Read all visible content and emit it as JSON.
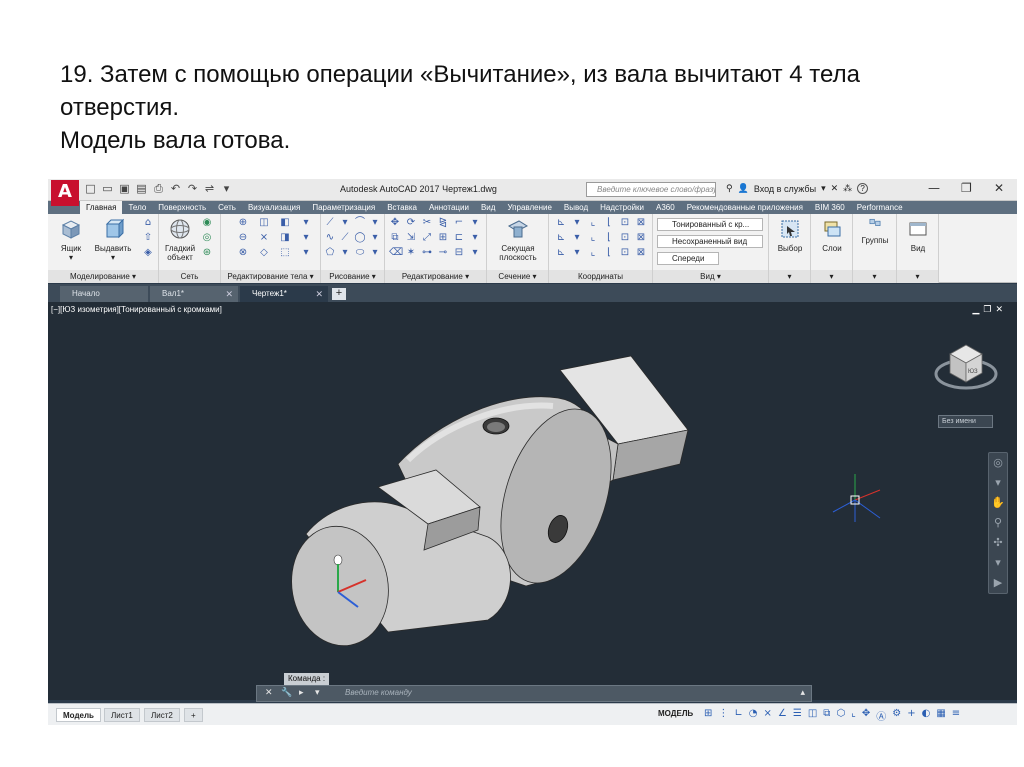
{
  "slide": {
    "caption_lines": [
      "19. Затем с помощью операции «Вычитание», из вала вычитают 4 тела",
      "отверстия.",
      "Модель вала готова."
    ]
  },
  "app": {
    "logo": "A",
    "title": "Autodesk AutoCAD 2017   Чертеж1.dwg",
    "search_placeholder": "Введите ключевое слово/фразу",
    "signin": "Вход в службы",
    "help": "?"
  },
  "ribbon_tabs": [
    "Главная",
    "Тело",
    "Поверхность",
    "Сеть",
    "Визуализация",
    "Параметризация",
    "Вставка",
    "Аннотации",
    "Вид",
    "Управление",
    "Вывод",
    "Надстройки",
    "A360",
    "Рекомендованные приложения",
    "BIM 360",
    "Performance"
  ],
  "ribbon": {
    "box_label": "Ящик",
    "extrude_label": "Выдавить",
    "smooth_label_1": "Гладкий",
    "smooth_label_2": "объект",
    "section_plane_1": "Секущая",
    "section_plane_2": "плоскость",
    "visual_style": "Тонированный с кр...",
    "unsaved_view": "Несохраненный вид",
    "view_front": "Спереди",
    "select_label": "Выбор",
    "layers_label": "Слои",
    "groups_label": "Группы",
    "view_label": "Вид",
    "panels": [
      "Моделирование ▾",
      "Сеть",
      "Редактирование тела ▾",
      "Рисование ▾",
      "Редактирование ▾",
      "Сечение ▾",
      "Координаты",
      "Вид ▾"
    ]
  },
  "file_tabs": {
    "start": "Начало",
    "shaft": "Вал1*",
    "drawing": "Чертеж1*"
  },
  "viewport": {
    "label": "[−][ЮЗ изометрия][Тонированный с кромками]",
    "named_view": "Без имени",
    "viewcube_face": "ЮЗ"
  },
  "command": {
    "label": "Команда :",
    "placeholder": "Введите  команду"
  },
  "status": {
    "tabs": [
      "Модель",
      "Лист1",
      "Лист2"
    ],
    "mode": "МОДЕЛЬ"
  }
}
